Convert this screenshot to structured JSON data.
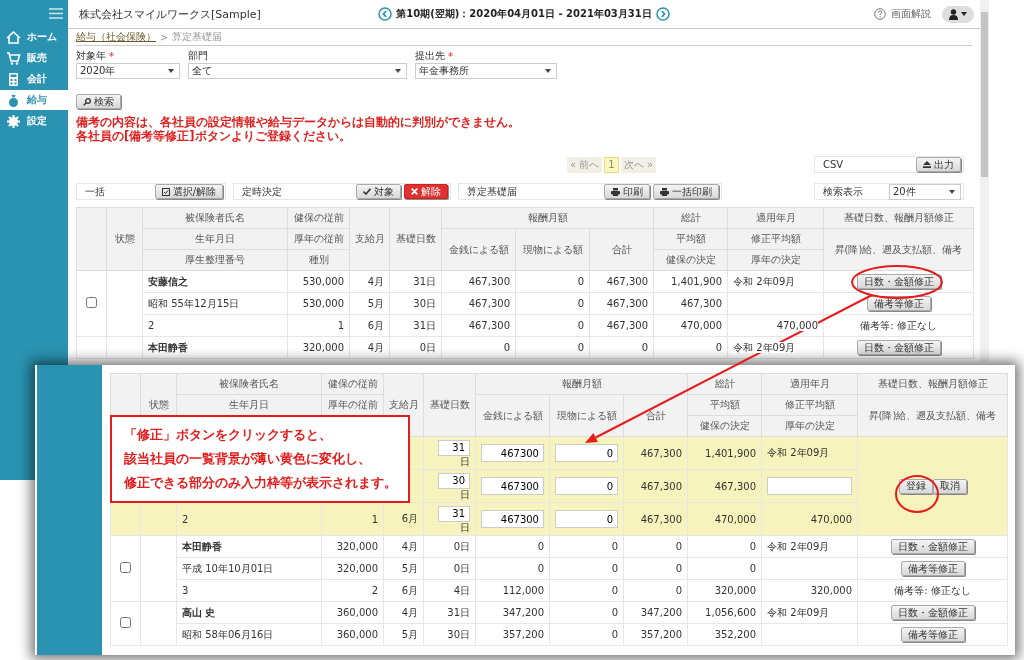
{
  "app": {
    "company": "株式会社スマイルワークス[Sample]",
    "period": "第10期(翌期)：2020年04月01日 - 2021年03月31日",
    "help": "画面解説"
  },
  "sidebar": {
    "items": [
      {
        "label": "ホーム",
        "kind": "home",
        "selected": false
      },
      {
        "label": "販売",
        "kind": "cart",
        "selected": false
      },
      {
        "label": "会計",
        "kind": "calculator",
        "selected": false
      },
      {
        "label": "給与",
        "kind": "bag",
        "selected": true
      },
      {
        "label": "設定",
        "kind": "gear",
        "selected": false
      }
    ]
  },
  "breadcrumb": {
    "link": "給与（社会保険）",
    "separator": ">",
    "current": "算定基礎届"
  },
  "filters": [
    {
      "label": "対象年",
      "required_mark": "*",
      "value": "2020年"
    },
    {
      "label": "部門",
      "value": "全て"
    },
    {
      "label": "提出先",
      "required_mark": "*",
      "value": "年金事務所"
    }
  ],
  "search_button": "検索",
  "notice": [
    "備考の内容は、各社員の設定情報や給与データからは自動的に判別ができません。",
    "各社員の[備考等修正]ボタンよりご登録ください。"
  ],
  "pagination": {
    "prev": "« 前へ",
    "pages": [
      {
        "label": "1",
        "selected": true
      }
    ],
    "next": "次へ »"
  },
  "csv": {
    "label": "CSV",
    "button": "出力"
  },
  "toolbar": {
    "bulk": {
      "label": "一括",
      "button": "選択/解除"
    },
    "regular": {
      "label": "定時決定",
      "buttons": [
        {
          "label": "対象",
          "kind": "check"
        },
        {
          "label": "解除",
          "kind": "danger"
        }
      ]
    },
    "form": {
      "label": "算定基礎届",
      "buttons": [
        {
          "label": "印刷",
          "kind": "print"
        },
        {
          "label": "一括印刷",
          "kind": "print"
        }
      ]
    },
    "display": {
      "label": "検索表示",
      "value": "20件"
    }
  },
  "table": {
    "header": {
      "status": "状態",
      "name": [
        "被保険者氏名",
        "生年月日",
        "厚生整理番号"
      ],
      "prev": [
        "健保の従前",
        "厚年の従前",
        "種別"
      ],
      "month": "支給月",
      "days": "基礎日数",
      "pay_title": "報酬月額",
      "pay": [
        "金銭による額",
        "現物による額",
        "合計"
      ],
      "sum": [
        "総計",
        "平均額",
        "健保の決定"
      ],
      "applied": [
        "適用年月",
        "修正平均額",
        "厚年の決定"
      ],
      "fix": [
        "基礎日数、報酬月額修正",
        "昇(降)給、遡及支払額、備考"
      ]
    },
    "groups": [
      {
        "editing": false,
        "checkbox": {
          "checked": false
        },
        "rows": [
          {
            "cells": [
              "安藤信之",
              "530,000",
              "4月",
              "31日",
              "467,300",
              "0",
              "467,300",
              "1,401,900",
              "令和 2年09月"
            ],
            "action": {
              "kind": "button",
              "label": "日数・金額修正"
            }
          },
          {
            "cells": [
              "昭和 55年12月15日",
              "530,000",
              "5月",
              "30日",
              "467,300",
              "0",
              "467,300",
              "467,300",
              null
            ],
            "action": {
              "kind": "button",
              "label": "備考等修正"
            }
          },
          {
            "cells": [
              "2",
              "1",
              "6月",
              "31日",
              "467,300",
              "0",
              "467,300",
              "470,000",
              "470,000"
            ],
            "action": {
              "kind": "text",
              "text": "備考等: 修正なし"
            }
          }
        ]
      },
      {
        "editing": false,
        "rows": [
          {
            "cells": [
              "本田静香",
              "320,000",
              "4月",
              "0日",
              "0",
              "0",
              "0",
              "0",
              "令和 2年09月"
            ],
            "action": {
              "kind": "button",
              "label": "日数・金額修正"
            }
          }
        ]
      }
    ]
  },
  "zoom_panel": {
    "table": {
      "header": {
        "status": "状態",
        "name": [
          "被保険者氏名",
          "生年月日"
        ],
        "prev": [
          "健保の従前",
          "厚年の従前"
        ],
        "month": "支給月",
        "days": "基礎日数",
        "pay_title": "報酬月額",
        "pay": [
          "金銭による額",
          "現物による額",
          "合計"
        ],
        "sum": [
          "総計",
          "平均額",
          "健保の決定"
        ],
        "applied": [
          "適用年月",
          "修正平均額",
          "厚年の決定"
        ],
        "fix": [
          "基礎日数、報酬月額修正",
          "昇(降)給、遡及支払額、備考"
        ]
      },
      "groups": [
        {
          "editing": true,
          "action_buttons": [
            {
              "label": "登録"
            },
            {
              "label": "取消"
            }
          ],
          "rows": [
            {
              "cells": [
                null,
                null,
                null,
                {
                  "kind": "input",
                  "value": "31",
                  "unit": "日"
                },
                {
                  "kind": "input",
                  "value": "467300"
                },
                {
                  "kind": "input",
                  "value": "0"
                },
                "467,300",
                "1,401,900",
                "令和 2年09月"
              ]
            },
            {
              "cells": [
                null,
                null,
                null,
                {
                  "kind": "input",
                  "value": "30",
                  "unit": "日"
                },
                {
                  "kind": "input",
                  "value": "467300"
                },
                {
                  "kind": "input",
                  "value": "0"
                },
                "467,300",
                "467,300",
                {
                  "kind": "input"
                }
              ]
            },
            {
              "cells": [
                "2",
                "1",
                "6月",
                {
                  "kind": "input",
                  "value": "31",
                  "unit": "日"
                },
                {
                  "kind": "input",
                  "value": "467300"
                },
                {
                  "kind": "input",
                  "value": "0"
                },
                "467,300",
                "470,000",
                "470,000"
              ]
            }
          ]
        },
        {
          "editing": false,
          "checkbox": {
            "checked": false
          },
          "rows": [
            {
              "cells": [
                "本田静香",
                "320,000",
                "4月",
                "0日",
                "0",
                "0",
                "0",
                "0",
                "令和 2年09月"
              ],
              "action": {
                "kind": "button",
                "label": "日数・金額修正"
              }
            },
            {
              "cells": [
                "平成 10年10月01日",
                "320,000",
                "5月",
                "0日",
                "0",
                "0",
                "0",
                "0",
                null
              ],
              "action": {
                "kind": "button",
                "label": "備考等修正"
              }
            },
            {
              "cells": [
                "3",
                "2",
                "6月",
                "4日",
                "112,000",
                "0",
                "0",
                "320,000",
                "320,000"
              ],
              "action": {
                "kind": "text",
                "text": "備考等: 修正なし"
              }
            }
          ]
        },
        {
          "editing": false,
          "checkbox": {
            "checked": false
          },
          "rows": [
            {
              "cells": [
                "高山 史",
                "360,000",
                "4月",
                "31日",
                "347,200",
                "0",
                "347,200",
                "1,056,600",
                "令和 2年09月"
              ],
              "action": {
                "kind": "button",
                "label": "日数・金額修正"
              }
            },
            {
              "cells": [
                "昭和 58年06月16日",
                "360,000",
                "5月",
                "30日",
                "357,200",
                "0",
                "357,200",
                "352,200",
                null
              ],
              "action": {
                "kind": "button",
                "label": "備考等修正"
              }
            }
          ]
        }
      ]
    }
  },
  "callout": {
    "lines": [
      "「修正」ボタンをクリックすると、",
      "該当社員の一覧背景が薄い黄色に変化し、",
      "修正できる部分のみ入力枠等が表示されます。"
    ]
  }
}
